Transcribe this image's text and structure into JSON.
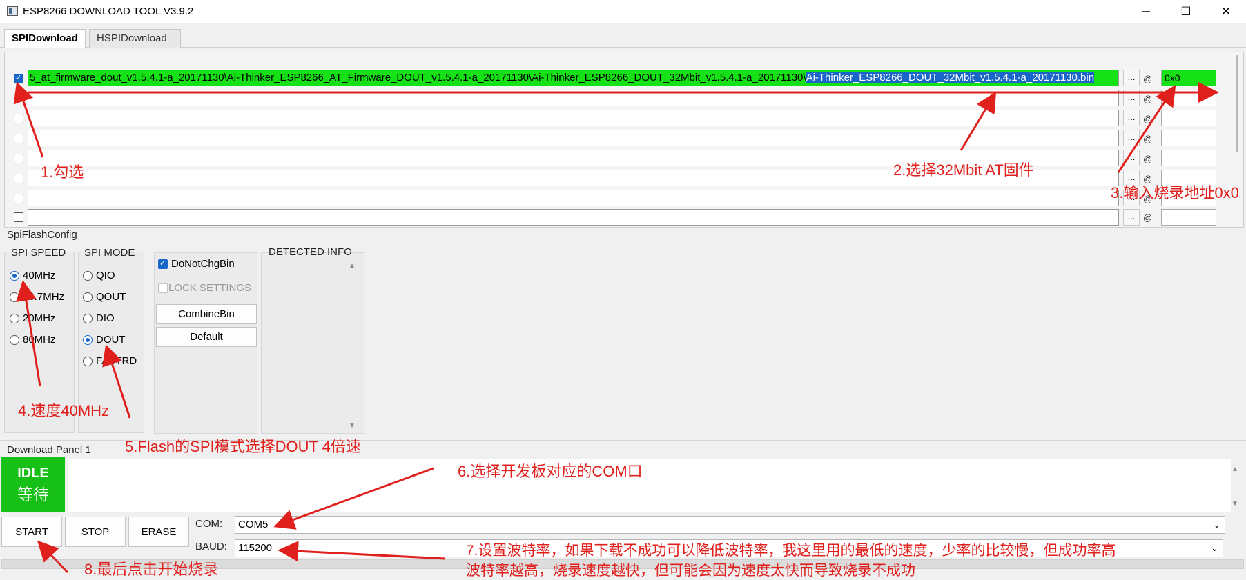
{
  "window": {
    "title": "ESP8266 DOWNLOAD TOOL V3.9.2",
    "min_glyph": "─",
    "max_glyph": "☐",
    "close_glyph": "✕"
  },
  "tabs": [
    {
      "label": "SPIDownload",
      "active": true
    },
    {
      "label": "HSPIDownload",
      "active": false
    }
  ],
  "file_rows": [
    {
      "checked": true,
      "path_prefix": "5_at_firmware_dout_v1.5.4.1-a_20171130\\Ai-Thinker_ESP8266_AT_Firmware_DOUT_v1.5.4.1-a_20171130\\Ai-Thinker_ESP8266_DOUT_32Mbit_v1.5.4.1-a_20171130\\",
      "path_selected": "Ai-Thinker_ESP8266_DOUT_32Mbit_v1.5.4.1-a_20171130.bin",
      "browse": "...",
      "at": "@",
      "address": "0x0"
    },
    {
      "checked": false,
      "path_prefix": "",
      "path_selected": "",
      "browse": "...",
      "at": "@",
      "address": ""
    },
    {
      "checked": false,
      "path_prefix": "",
      "path_selected": "",
      "browse": "...",
      "at": "@",
      "address": ""
    },
    {
      "checked": false,
      "path_prefix": "",
      "path_selected": "",
      "browse": "...",
      "at": "@",
      "address": ""
    },
    {
      "checked": false,
      "path_prefix": "",
      "path_selected": "",
      "browse": "...",
      "at": "@",
      "address": ""
    },
    {
      "checked": false,
      "path_prefix": "",
      "path_selected": "",
      "browse": "...",
      "at": "@",
      "address": ""
    },
    {
      "checked": false,
      "path_prefix": "",
      "path_selected": "",
      "browse": "...",
      "at": "@",
      "address": ""
    },
    {
      "checked": false,
      "path_prefix": "",
      "path_selected": "",
      "browse": "...",
      "at": "@",
      "address": ""
    }
  ],
  "spi_flash_config": {
    "title": "SpiFlashConfig",
    "spi_speed": {
      "label": "SPI SPEED",
      "options": [
        "40MHz",
        "26.7MHz",
        "20MHz",
        "80MHz"
      ],
      "selected": "40MHz"
    },
    "spi_mode": {
      "label": "SPI MODE",
      "options": [
        "QIO",
        "QOUT",
        "DIO",
        "DOUT",
        "FASTRD"
      ],
      "selected": "DOUT"
    },
    "do_not_chg_bin": {
      "label": "DoNotChgBin",
      "checked": true
    },
    "lock_settings": {
      "label": "LOCK SETTINGS",
      "checked": false
    },
    "combine_bin_label": "CombineBin",
    "default_label": "Default",
    "detected_info_label": "DETECTED INFO"
  },
  "download_panel": {
    "title": "Download Panel 1",
    "status": "IDLE",
    "status_cn": "等待",
    "start_label": "START",
    "stop_label": "STOP",
    "erase_label": "ERASE",
    "com_label": "COM:",
    "com_value": "COM5",
    "baud_label": "BAUD:",
    "baud_value": "115200"
  },
  "annotations": {
    "n1": "1.勾选",
    "n2": "2.选择32Mbit AT固件",
    "n3": "3.输入烧录地址0x0",
    "n4": "4.速度40MHz",
    "n5": "5.Flash的SPI模式选择DOUT 4倍速",
    "n6": "6.选择开发板对应的COM口",
    "n7a": "7.设置波特率，如果下载不成功可以降低波特率，我这里用的最低的速度，少率的比较慢，但成功率高",
    "n7b": "波特率越高，烧录速度越快，但可能会因为速度太快而导致烧录不成功",
    "n8": "8.最后点击开始烧录"
  },
  "colors": {
    "accent": "#1a66c8",
    "selected_file_bg": "#16e016",
    "idle_bg": "#16c016",
    "annotation": "#e0201d"
  }
}
